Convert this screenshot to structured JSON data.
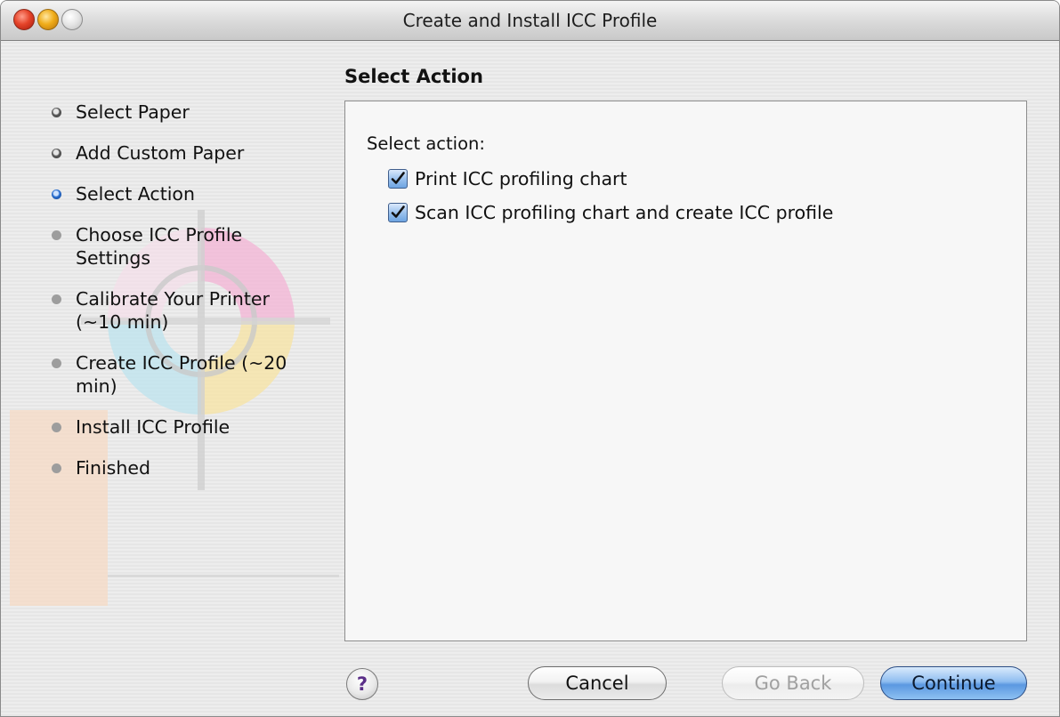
{
  "window": {
    "title": "Create and Install ICC Profile"
  },
  "steps": [
    {
      "label": "Select Paper",
      "state": "done"
    },
    {
      "label": "Add Custom Paper",
      "state": "done"
    },
    {
      "label": "Select Action",
      "state": "current"
    },
    {
      "label": "Choose ICC Profile Settings",
      "state": "pending"
    },
    {
      "label": "Calibrate Your Printer (~10 min)",
      "state": "pending"
    },
    {
      "label": "Create ICC Profile (~20 min)",
      "state": "pending"
    },
    {
      "label": "Install ICC Profile",
      "state": "pending"
    },
    {
      "label": "Finished",
      "state": "pending"
    }
  ],
  "panel": {
    "title": "Select Action",
    "section_label": "Select action:",
    "options": [
      {
        "label": "Print ICC profiling chart",
        "checked": true
      },
      {
        "label": "Scan ICC profiling chart and create ICC profile",
        "checked": true
      }
    ]
  },
  "buttons": {
    "help": "?",
    "cancel": "Cancel",
    "go_back": "Go Back",
    "continue": "Continue"
  },
  "colors": {
    "accent_blue": "#5b98e1",
    "current_step_dot": "#2a6fd0"
  }
}
